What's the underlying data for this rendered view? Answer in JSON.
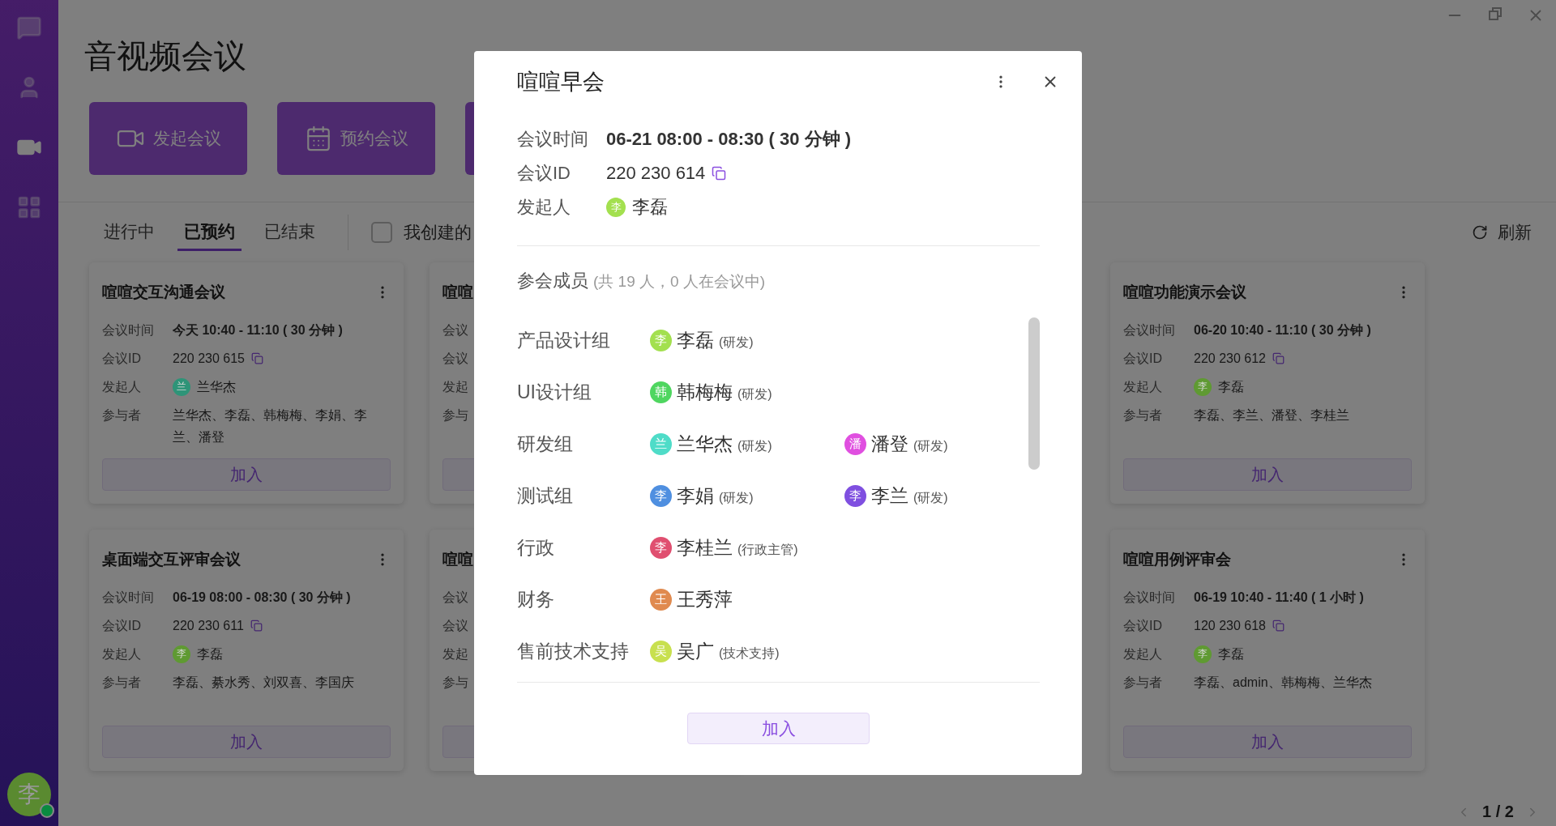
{
  "nav": [
    {
      "kind": "chat",
      "selected": false
    },
    {
      "kind": "contacts",
      "selected": false
    },
    {
      "kind": "video",
      "selected": true
    },
    {
      "kind": "apps",
      "selected": false
    }
  ],
  "user": {
    "avatar": "李",
    "color": "#5a8a30",
    "online": true
  },
  "title": "音视频会议",
  "action_buttons": [
    {
      "kind": "video",
      "label": "发起会议"
    },
    {
      "kind": "calendar",
      "label": "预约会议"
    },
    {
      "kind": "other"
    }
  ],
  "tabs": [
    {
      "label": "进行中",
      "selected": false
    },
    {
      "label": "已预约",
      "selected": true
    },
    {
      "label": "已结束",
      "selected": false
    }
  ],
  "filter": {
    "label": "我创建的",
    "checked": false
  },
  "refresh": "刷新",
  "cards": [
    {
      "title": "喧喧交互沟通会议",
      "rows": [
        {
          "kind": "time",
          "label": "会议时间",
          "value": "今天 10:40 - 11:10 ( 30 分钟 )"
        },
        {
          "kind": "id",
          "label": "会议ID",
          "value": "220 230 615"
        },
        {
          "kind": "host",
          "label": "发起人",
          "value": "兰华杰",
          "avatar": "兰",
          "color": "#2e9478"
        },
        {
          "kind": "people",
          "label": "参与者",
          "value": "兰华杰、李磊、韩梅梅、李娟、李兰、潘登"
        }
      ],
      "join": "加入"
    },
    {
      "title": "喧喧",
      "rows": [
        {
          "kind": "time",
          "label": "会议"
        },
        {
          "kind": "id",
          "label": "会议"
        },
        {
          "kind": "host",
          "label": "发起"
        },
        {
          "kind": "people",
          "label": "参与"
        }
      ]
    },
    {
      "title": "喧喧功能演示会议",
      "rows": [
        {
          "kind": "time",
          "label": "会议时间",
          "value": "06-20 10:40 - 11:10 ( 30 分钟 )"
        },
        {
          "kind": "id",
          "label": "会议ID",
          "value": "220 230 612"
        },
        {
          "kind": "host",
          "label": "发起人",
          "value": "李磊",
          "avatar": "李",
          "color": "#5f9a32"
        },
        {
          "kind": "people",
          "label": "参与者",
          "value": "李磊、李兰、潘登、李桂兰"
        }
      ],
      "join": "加入"
    },
    {
      "title": "桌面端交互评审会议",
      "rows": [
        {
          "kind": "time",
          "label": "会议时间",
          "value": "06-19 08:00 - 08:30 ( 30 分钟 )"
        },
        {
          "kind": "id",
          "label": "会议ID",
          "value": "220 230 611"
        },
        {
          "kind": "host",
          "label": "发起人",
          "value": "李磊",
          "avatar": "李",
          "color": "#5f9a32"
        },
        {
          "kind": "people",
          "label": "参与者",
          "value": "李磊、綦水秀、刘双喜、李国庆"
        }
      ],
      "join": "加入"
    },
    {
      "title": "喧喧",
      "rows": [
        {
          "kind": "time",
          "label": "会议"
        },
        {
          "kind": "id",
          "label": "会议"
        },
        {
          "kind": "host",
          "label": "发起"
        },
        {
          "kind": "people",
          "label": "参与"
        }
      ]
    },
    {
      "title": "喧喧用例评审会",
      "rows": [
        {
          "kind": "time",
          "label": "会议时间",
          "value": "06-19 10:40 - 11:40 ( 1 小时 )"
        },
        {
          "kind": "id",
          "label": "会议ID",
          "value": "120 230 618"
        },
        {
          "kind": "host",
          "label": "发起人",
          "value": "李磊",
          "avatar": "李",
          "color": "#5f9a32"
        },
        {
          "kind": "people",
          "label": "参与者",
          "value": "李磊、admin、韩梅梅、兰华杰"
        }
      ],
      "join": "加入"
    }
  ],
  "pager": "1 / 2",
  "dialog": {
    "title": "喧喧早会",
    "rows": [
      {
        "kind": "time",
        "label": "会议时间",
        "value": "06-21 08:00 - 08:30 ( 30 分钟 )"
      },
      {
        "kind": "id",
        "label": "会议ID",
        "value": "220 230 614"
      },
      {
        "kind": "host",
        "label": "发起人",
        "value": "李磊",
        "avatar": "李",
        "color": "#a3e04f"
      }
    ],
    "members_title": "参会成员",
    "members_count": "(共 19 人，0 人在会议中)",
    "groups": [
      {
        "name": "产品设计组",
        "members": [
          {
            "name": "李磊",
            "role": "(研发)",
            "avatar": "李",
            "color": "#a3e04f"
          }
        ]
      },
      {
        "name": "UI设计组",
        "members": [
          {
            "name": "韩梅梅",
            "role": "(研发)",
            "avatar": "韩",
            "color": "#4fd660"
          }
        ]
      },
      {
        "name": "研发组",
        "members": [
          {
            "name": "兰华杰",
            "role": "(研发)",
            "avatar": "兰",
            "color": "#4fdcc8"
          },
          {
            "name": "潘登",
            "role": "(研发)",
            "avatar": "潘",
            "color": "#e04fe0"
          }
        ]
      },
      {
        "name": "测试组",
        "members": [
          {
            "name": "李娟",
            "role": "(研发)",
            "avatar": "李",
            "color": "#4f8fe0"
          },
          {
            "name": "李兰",
            "role": "(研发)",
            "avatar": "李",
            "color": "#7f4fe0"
          }
        ]
      },
      {
        "name": "行政",
        "members": [
          {
            "name": "李桂兰",
            "role": "(行政主管)",
            "avatar": "李",
            "color": "#e04f70"
          }
        ]
      },
      {
        "name": "财务",
        "members": [
          {
            "name": "王秀萍",
            "avatar": "王",
            "color": "#e08a4f"
          }
        ]
      },
      {
        "name": "售前技术支持",
        "members": [
          {
            "name": "吴广",
            "role": "(技术支持)",
            "avatar": "吴",
            "color": "#c8e04f"
          }
        ]
      }
    ],
    "join": "加入"
  }
}
